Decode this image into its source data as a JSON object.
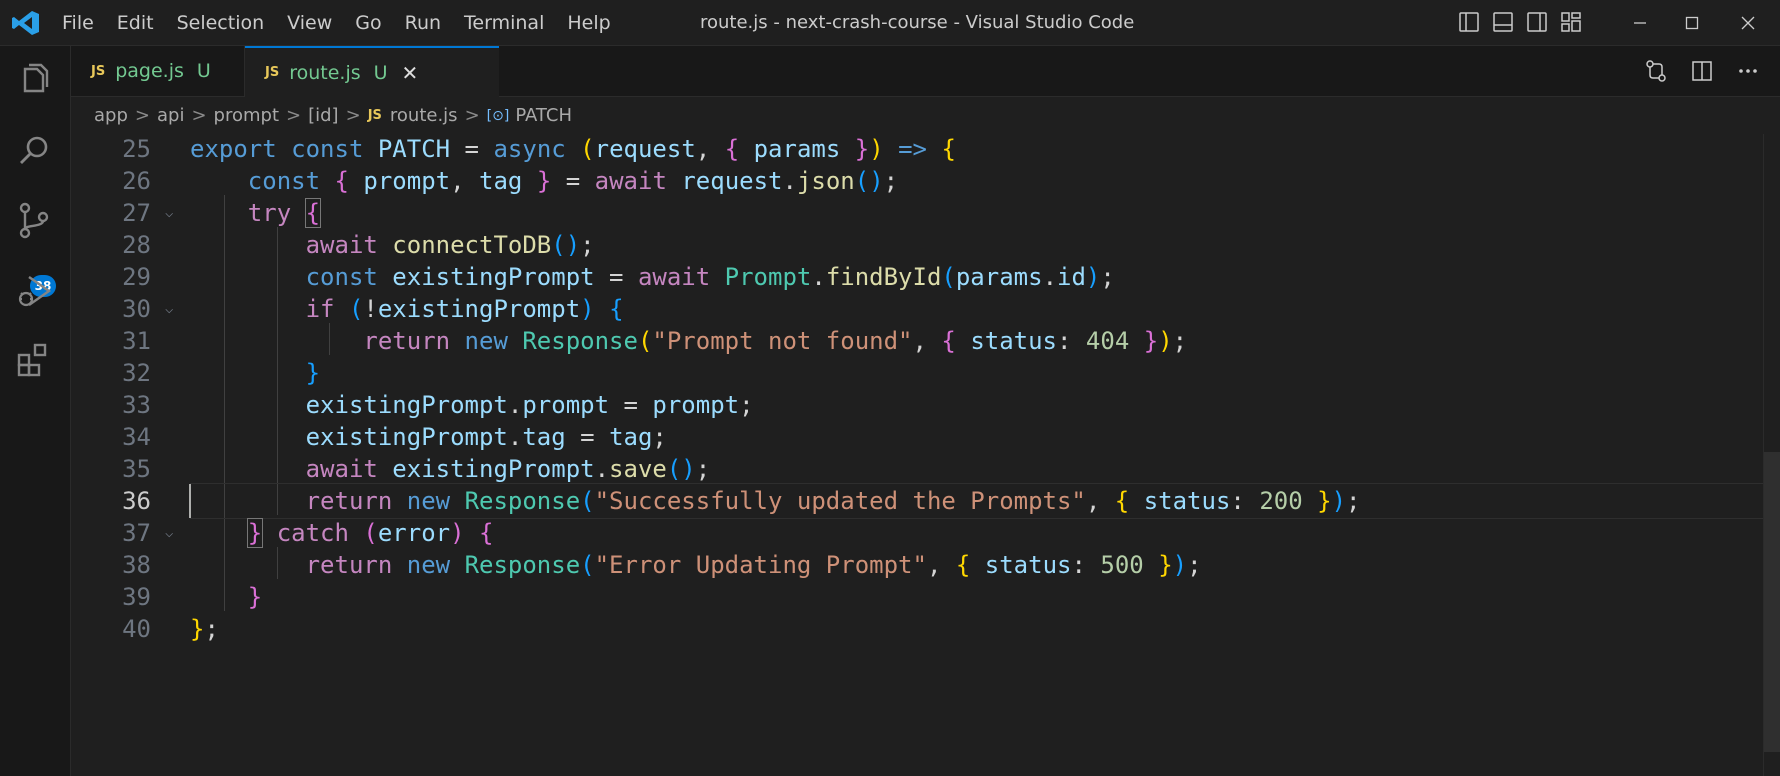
{
  "menu": [
    "File",
    "Edit",
    "Selection",
    "View",
    "Go",
    "Run",
    "Terminal",
    "Help"
  ],
  "window_title": "route.js - next-crash-course - Visual Studio Code",
  "activity": {
    "scm_badge": "38"
  },
  "tabs": [
    {
      "icon_label": "JS",
      "name": "page.js",
      "status": "U"
    },
    {
      "icon_label": "JS",
      "name": "route.js",
      "status": "U",
      "close": "✕"
    }
  ],
  "breadcrumb": {
    "parts": [
      "app",
      "api",
      "prompt",
      "[id]"
    ],
    "js_label": "JS",
    "file": "route.js",
    "symbol": "PATCH"
  },
  "code": {
    "line_numbers": [
      "25",
      "26",
      "27",
      "28",
      "29",
      "30",
      "31",
      "32",
      "33",
      "34",
      "35",
      "36",
      "37",
      "38",
      "39",
      "40"
    ],
    "active_line": "36",
    "lines": [
      [
        [
          "k",
          "export"
        ],
        [
          "w",
          " "
        ],
        [
          "k",
          "const"
        ],
        [
          "w",
          " "
        ],
        [
          "v",
          "PATCH"
        ],
        [
          "w",
          " = "
        ],
        [
          "k",
          "async"
        ],
        [
          "w",
          " "
        ],
        [
          "b1",
          "("
        ],
        [
          "v",
          "request"
        ],
        [
          "w",
          ", "
        ],
        [
          "b2",
          "{"
        ],
        [
          "w",
          " "
        ],
        [
          "v",
          "params"
        ],
        [
          "w",
          " "
        ],
        [
          "b2",
          "}"
        ],
        [
          "b1",
          ")"
        ],
        [
          "w",
          " "
        ],
        [
          "k",
          "=>"
        ],
        [
          "w",
          " "
        ],
        [
          "b1",
          "{"
        ]
      ],
      [
        [
          "w",
          "    "
        ],
        [
          "k",
          "const"
        ],
        [
          "w",
          " "
        ],
        [
          "b2",
          "{"
        ],
        [
          "w",
          " "
        ],
        [
          "v",
          "prompt"
        ],
        [
          "w",
          ", "
        ],
        [
          "v",
          "tag"
        ],
        [
          "w",
          " "
        ],
        [
          "b2",
          "}"
        ],
        [
          "w",
          " = "
        ],
        [
          "ctl",
          "await"
        ],
        [
          "w",
          " "
        ],
        [
          "v",
          "request"
        ],
        [
          "w",
          "."
        ],
        [
          "f",
          "json"
        ],
        [
          "b3",
          "("
        ],
        [
          "b3",
          ")"
        ],
        [
          "w",
          ";"
        ]
      ],
      [
        [
          "w",
          "    "
        ],
        [
          "ctl",
          "try"
        ],
        [
          "w",
          " "
        ],
        [
          "b2bm",
          "{"
        ]
      ],
      [
        [
          "w",
          "        "
        ],
        [
          "ctl",
          "await"
        ],
        [
          "w",
          " "
        ],
        [
          "f",
          "connectToDB"
        ],
        [
          "b3",
          "("
        ],
        [
          "b3",
          ")"
        ],
        [
          "w",
          ";"
        ]
      ],
      [
        [
          "w",
          "        "
        ],
        [
          "k",
          "const"
        ],
        [
          "w",
          " "
        ],
        [
          "v",
          "existingPrompt"
        ],
        [
          "w",
          " = "
        ],
        [
          "ctl",
          "await"
        ],
        [
          "w",
          " "
        ],
        [
          "t",
          "Prompt"
        ],
        [
          "w",
          "."
        ],
        [
          "f",
          "findById"
        ],
        [
          "b3",
          "("
        ],
        [
          "v",
          "params"
        ],
        [
          "w",
          "."
        ],
        [
          "v",
          "id"
        ],
        [
          "b3",
          ")"
        ],
        [
          "w",
          ";"
        ]
      ],
      [
        [
          "w",
          "        "
        ],
        [
          "ctl",
          "if"
        ],
        [
          "w",
          " "
        ],
        [
          "b3",
          "("
        ],
        [
          "w",
          "!"
        ],
        [
          "v",
          "existingPrompt"
        ],
        [
          "b3",
          ")"
        ],
        [
          "w",
          " "
        ],
        [
          "b3",
          "{"
        ]
      ],
      [
        [
          "w",
          "            "
        ],
        [
          "ctl",
          "return"
        ],
        [
          "w",
          " "
        ],
        [
          "k",
          "new"
        ],
        [
          "w",
          " "
        ],
        [
          "t",
          "Response"
        ],
        [
          "b1",
          "("
        ],
        [
          "s",
          "\"Prompt not found\""
        ],
        [
          "w",
          ", "
        ],
        [
          "b2",
          "{"
        ],
        [
          "w",
          " "
        ],
        [
          "v",
          "status"
        ],
        [
          "w",
          ": "
        ],
        [
          "n",
          "404"
        ],
        [
          "w",
          " "
        ],
        [
          "b2",
          "}"
        ],
        [
          "b1",
          ")"
        ],
        [
          "w",
          ";"
        ]
      ],
      [
        [
          "w",
          "        "
        ],
        [
          "b3",
          "}"
        ]
      ],
      [
        [
          "w",
          "        "
        ],
        [
          "v",
          "existingPrompt"
        ],
        [
          "w",
          "."
        ],
        [
          "v",
          "prompt"
        ],
        [
          "w",
          " = "
        ],
        [
          "v",
          "prompt"
        ],
        [
          "w",
          ";"
        ]
      ],
      [
        [
          "w",
          "        "
        ],
        [
          "v",
          "existingPrompt"
        ],
        [
          "w",
          "."
        ],
        [
          "v",
          "tag"
        ],
        [
          "w",
          " = "
        ],
        [
          "v",
          "tag"
        ],
        [
          "w",
          ";"
        ]
      ],
      [
        [
          "w",
          "        "
        ],
        [
          "ctl",
          "await"
        ],
        [
          "w",
          " "
        ],
        [
          "v",
          "existingPrompt"
        ],
        [
          "w",
          "."
        ],
        [
          "f",
          "save"
        ],
        [
          "b3",
          "("
        ],
        [
          "b3",
          ")"
        ],
        [
          "w",
          ";"
        ]
      ],
      [
        [
          "w",
          "        "
        ],
        [
          "ctl",
          "return"
        ],
        [
          "w",
          " "
        ],
        [
          "k",
          "new"
        ],
        [
          "w",
          " "
        ],
        [
          "t",
          "Response"
        ],
        [
          "b3",
          "("
        ],
        [
          "s",
          "\"Successfully updated the Prompts\""
        ],
        [
          "w",
          ", "
        ],
        [
          "b1",
          "{"
        ],
        [
          "w",
          " "
        ],
        [
          "v",
          "status"
        ],
        [
          "w",
          ": "
        ],
        [
          "n",
          "200"
        ],
        [
          "w",
          " "
        ],
        [
          "b1",
          "}"
        ],
        [
          "b3",
          ")"
        ],
        [
          "w",
          ";"
        ]
      ],
      [
        [
          "w",
          "    "
        ],
        [
          "b2bm",
          "}"
        ],
        [
          "w",
          " "
        ],
        [
          "ctl",
          "catch"
        ],
        [
          "w",
          " "
        ],
        [
          "b2",
          "("
        ],
        [
          "v",
          "error"
        ],
        [
          "b2",
          ")"
        ],
        [
          "w",
          " "
        ],
        [
          "b2",
          "{"
        ]
      ],
      [
        [
          "w",
          "        "
        ],
        [
          "ctl",
          "return"
        ],
        [
          "w",
          " "
        ],
        [
          "k",
          "new"
        ],
        [
          "w",
          " "
        ],
        [
          "t",
          "Response"
        ],
        [
          "b3",
          "("
        ],
        [
          "s",
          "\"Error Updating Prompt\""
        ],
        [
          "w",
          ", "
        ],
        [
          "b1",
          "{"
        ],
        [
          "w",
          " "
        ],
        [
          "v",
          "status"
        ],
        [
          "w",
          ": "
        ],
        [
          "n",
          "500"
        ],
        [
          "w",
          " "
        ],
        [
          "b1",
          "}"
        ],
        [
          "b3",
          ")"
        ],
        [
          "w",
          ";"
        ]
      ],
      [
        [
          "w",
          "    "
        ],
        [
          "b2",
          "}"
        ]
      ],
      [
        [
          "b1",
          "}"
        ],
        [
          "w",
          ";"
        ]
      ]
    ]
  }
}
